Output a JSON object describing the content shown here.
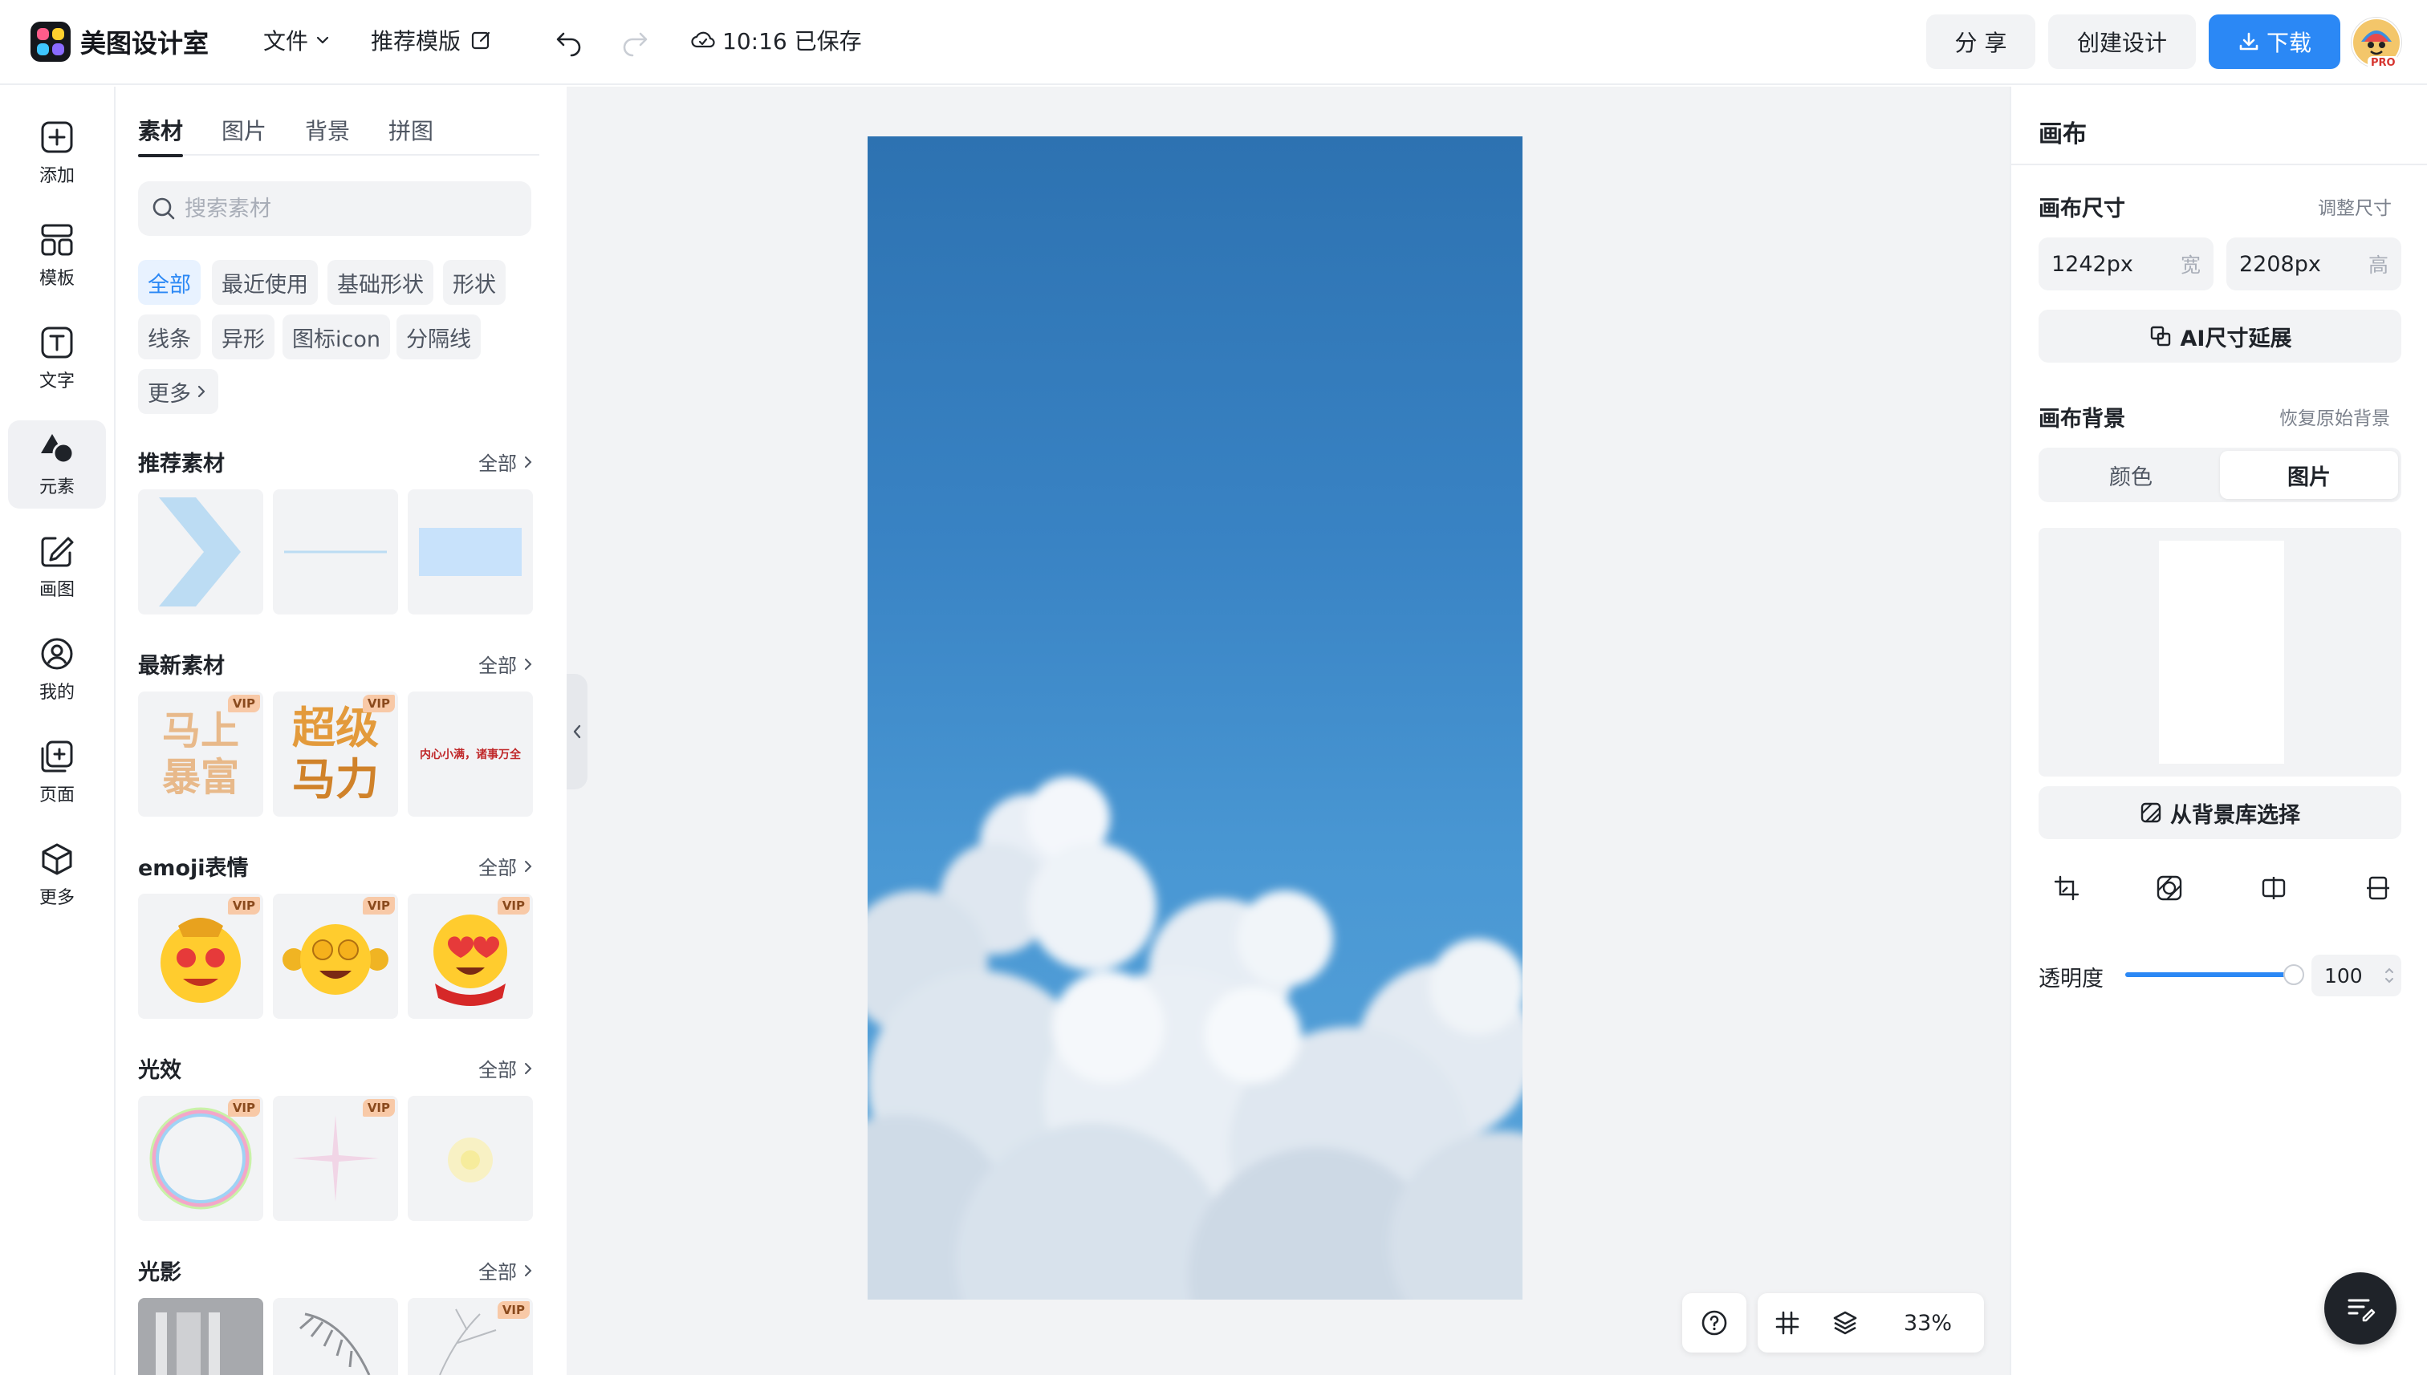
{
  "app": {
    "name": "美图设计室"
  },
  "header": {
    "file_menu": "文件",
    "templates_link": "推荐模版",
    "save_status": "10:16 已保存",
    "share": "分 享",
    "create": "创建设计",
    "download": "下载",
    "avatar_badge": "PRO",
    "accent_color": "#2b88f5"
  },
  "sidebar": {
    "items": [
      {
        "label": "添加",
        "icon": "add-icon"
      },
      {
        "label": "模板",
        "icon": "template-icon"
      },
      {
        "label": "文字",
        "icon": "text-icon"
      },
      {
        "label": "元素",
        "icon": "shapes-icon",
        "active": true
      },
      {
        "label": "画图",
        "icon": "draw-icon"
      },
      {
        "label": "我的",
        "icon": "user-icon"
      },
      {
        "label": "页面",
        "icon": "page-icon"
      },
      {
        "label": "更多",
        "icon": "box-icon"
      }
    ]
  },
  "materials": {
    "tabs": [
      "素材",
      "图片",
      "背景",
      "拼图"
    ],
    "active_tab": "素材",
    "search_placeholder": "搜索素材",
    "categories": [
      "全部",
      "最近使用",
      "基础形状",
      "形状",
      "线条",
      "异形",
      "图标icon",
      "分隔线",
      "更多"
    ],
    "active_category": "全部",
    "see_all": "全部",
    "vip_badge": "VIP",
    "sections": [
      {
        "title": "推荐素材"
      },
      {
        "title": "最新素材",
        "thumb_texts": [
          "马上",
          "暴富",
          "超级",
          "马力",
          "内心小满，诸事万全"
        ]
      },
      {
        "title": "emoji表情"
      },
      {
        "title": "光效"
      },
      {
        "title": "光影"
      }
    ]
  },
  "canvas": {
    "zoom": "33%"
  },
  "properties": {
    "title": "画布",
    "size_label": "画布尺寸",
    "resize_link": "调整尺寸",
    "width_value": "1242px",
    "width_unit": "宽",
    "height_value": "2208px",
    "height_unit": "高",
    "ai_extend": "AI尺寸延展",
    "bg_label": "画布背景",
    "restore_bg": "恢复原始背景",
    "bg_tabs": [
      "颜色",
      "图片"
    ],
    "active_bg_tab": "图片",
    "bg_library": "从背景库选择",
    "opacity_label": "透明度",
    "opacity_value": "100",
    "opacity_level": 100
  }
}
